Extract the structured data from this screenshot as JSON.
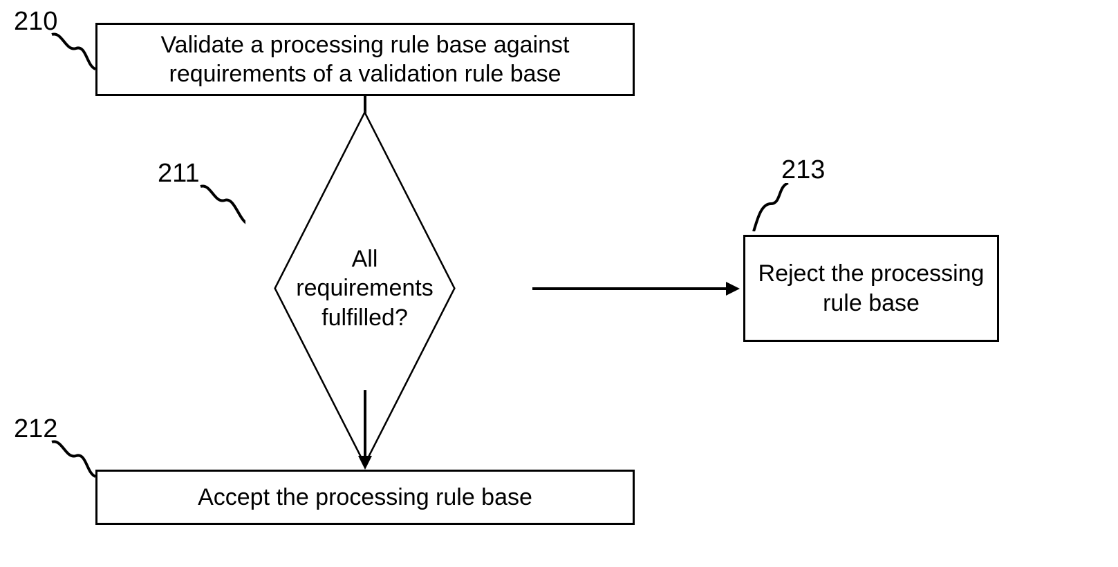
{
  "nodes": {
    "n210": {
      "ref": "210",
      "text": "Validate a processing rule base against requirements of a validation rule base"
    },
    "n211": {
      "ref": "211",
      "text": "All requirements fulfilled?"
    },
    "n212": {
      "ref": "212",
      "text": "Accept the processing rule base"
    },
    "n213": {
      "ref": "213",
      "text": "Reject the processing rule base"
    }
  }
}
